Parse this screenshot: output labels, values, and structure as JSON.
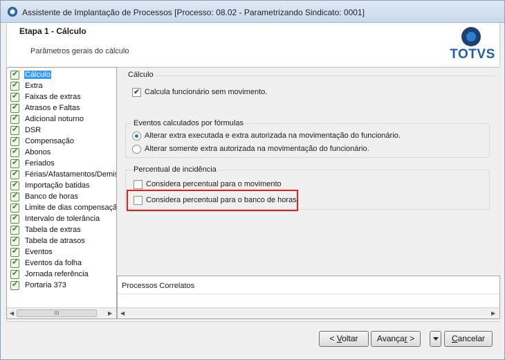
{
  "window": {
    "title": "Assistente de Implantação de Processos [Processo: 08.02 - Parametrizando Sindicato: 0001]"
  },
  "header": {
    "step_title": "Etapa 1 - Cálculo",
    "step_subtitle": "Parâmetros gerais do cálculo",
    "logo_text": "TOTVS"
  },
  "tree": {
    "items": [
      {
        "label": "Cálculo",
        "selected": true
      },
      {
        "label": "Extra"
      },
      {
        "label": "Faixas de extras"
      },
      {
        "label": "Atrasos e Faltas"
      },
      {
        "label": "Adicional noturno"
      },
      {
        "label": "DSR"
      },
      {
        "label": "Compensação"
      },
      {
        "label": "Abonos"
      },
      {
        "label": "Feriados"
      },
      {
        "label": "Férias/Afastamentos/Demis"
      },
      {
        "label": "Importação batidas"
      },
      {
        "label": "Banco de horas"
      },
      {
        "label": "Limite de dias compensação"
      },
      {
        "label": "Intervalo de tolerância"
      },
      {
        "label": "Tabela de extras"
      },
      {
        "label": "Tabela de atrasos"
      },
      {
        "label": "Eventos"
      },
      {
        "label": "Eventos da folha"
      },
      {
        "label": "Jornada referência"
      },
      {
        "label": "Portaria 373"
      }
    ],
    "scroll_thumb": "III"
  },
  "content": {
    "section_title": "Cálculo",
    "calcula_sem_movimento": {
      "label": "Calcula funcionário sem movimento.",
      "checked": true
    },
    "eventos_group": {
      "title": "Eventos calculados por fórmulas",
      "options": [
        {
          "label": "Alterar extra executada e extra autorizada na movimentação do funcionário.",
          "selected": true
        },
        {
          "label": "Alterar somente extra autorizada na movimentação do funcionário.",
          "selected": false
        }
      ]
    },
    "percentual_group": {
      "title": "Percentual de incidência",
      "movimento": {
        "label": "Considera percentual para o movimento",
        "checked": false
      },
      "banco_horas": {
        "label": "Considera percentual para o banco de horas",
        "checked": false
      }
    }
  },
  "related": {
    "title": "Processos Correlatos"
  },
  "footer": {
    "back": {
      "mnemonic": "V",
      "rest": "oltar",
      "prefix": "< "
    },
    "next": {
      "prefix": "Avança",
      "mnemonic": "r",
      "suffix": " >"
    },
    "cancel": {
      "mnemonic": "C",
      "rest": "ancelar"
    }
  },
  "colors": {
    "accent": "#3399ff",
    "highlight": "#e02020",
    "logo": "#1e5da8"
  }
}
